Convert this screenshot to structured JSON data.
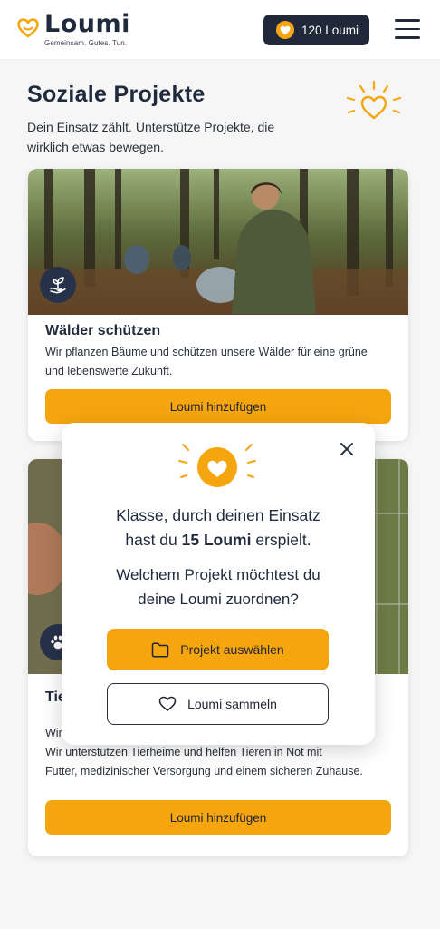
{
  "app": {
    "name": "Loumi",
    "tagline": "Gemeinsam. Gutes. Tun.",
    "balance": "120 Loumi"
  },
  "page": {
    "title": "Soziale Projekte",
    "subtitle": "Dein Einsatz zählt. Unterstütze Projekte, die wirklich etwas bewegen."
  },
  "projects": [
    {
      "title": "Wälder schützen",
      "description": "Wir pflanzen Bäume und schützen unsere Wälder für eine grüne und lebenswerte Zukunft.",
      "button": "Loumi hinzufügen",
      "icon": "plant-icon"
    },
    {
      "title": "Tie",
      "description_partial": "Wir",
      "description": "Wir unterstützen Tierheime und helfen Tieren in Not mit Futter, medizinischer Versorgung und einem sicheren Zuhause.",
      "description_visible_lines": [
        "Wir unterstützen Tierheime und helfen Tieren in Not mit",
        "Futter, medizinischer Versorgung und einem sicheren Zuhause."
      ],
      "button": "Loumi hinzufügen",
      "icon": "paw-icon"
    }
  ],
  "modal": {
    "message_prefix": "Klasse, durch deinen Einsatz",
    "message_mid": "hast du",
    "message_points": "15 Loumi",
    "message_suffix": "erspielt.",
    "question_line1": "Welchem Projekt möchtest du",
    "question_line2": "deine Loumi zuordnen?",
    "primary_button": "Projekt auswählen",
    "secondary_button": "Loumi sammeln"
  },
  "colors": {
    "accent": "#f5a60f",
    "navy": "#20293a",
    "background": "#f6f6f6"
  }
}
